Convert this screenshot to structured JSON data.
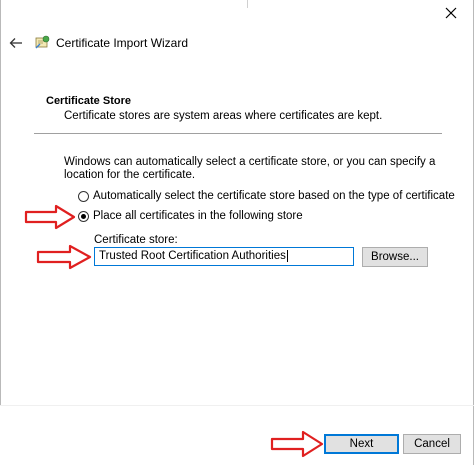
{
  "window": {
    "title": "Certificate Import Wizard"
  },
  "section": {
    "title": "Certificate Store",
    "description": "Certificate stores are system areas where certificates are kept."
  },
  "intro": "Windows can automatically select a certificate store, or you can specify a location for the certificate.",
  "options": {
    "auto_label": "Automatically select the certificate store based on the type of certificate",
    "manual_label": "Place all certificates in the following store",
    "selected": "manual"
  },
  "store": {
    "label": "Certificate store:",
    "value": "Trusted Root Certification Authorities",
    "browse_label": "Browse..."
  },
  "footer": {
    "next_label": "Next",
    "cancel_label": "Cancel"
  },
  "icons": {
    "close": "close-icon",
    "back": "back-arrow-icon",
    "wizard": "certificate-wizard-icon",
    "annotation": "red-arrow-annotation"
  },
  "colors": {
    "accent": "#0078d7",
    "annotation": "#e02020",
    "button_face": "#e1e1e1"
  }
}
